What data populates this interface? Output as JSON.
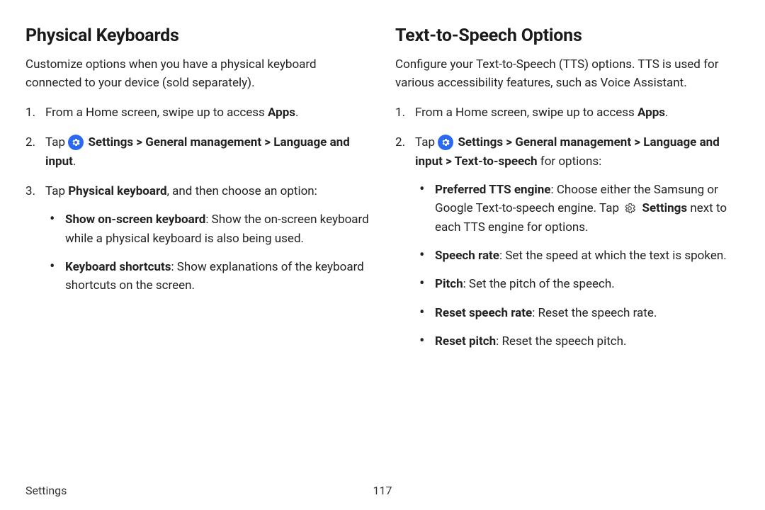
{
  "left": {
    "heading": "Physical Keyboards",
    "intro": "Customize options when you have a physical keyboard connected to your device (sold separately).",
    "step1_pre": "From a Home screen, swipe up to access ",
    "step1_bold": "Apps",
    "step1_post": ".",
    "step2_pre": "Tap ",
    "step2_bold": "Settings > General management > Language and input",
    "step2_post": ".",
    "step3_pre": "Tap ",
    "step3_bold": "Physical keyboard",
    "step3_post": ", and then choose an option:",
    "bullet1_bold": "Show on-screen keyboard",
    "bullet1_text": ": Show the on-screen keyboard while a physical keyboard is also being used.",
    "bullet2_bold": "Keyboard shortcuts",
    "bullet2_text": ": Show explanations of the keyboard shortcuts on the screen."
  },
  "right": {
    "heading": "Text-to-Speech Options",
    "intro": "Configure your Text-to-Speech (TTS) options. TTS is used for various accessibility features, such as Voice Assistant.",
    "step1_pre": "From a Home screen, swipe up to access ",
    "step1_bold": "Apps",
    "step1_post": ".",
    "step2_pre": "Tap ",
    "step2_bold": "Settings > General management > Language and input > Text-to-speech",
    "step2_post": " for options:",
    "b1_bold": "Preferred TTS engine",
    "b1_text1": ": Choose either the Samsung or Google Text-to-speech engine. Tap ",
    "b1_bold2": "Settings",
    "b1_text2": " next to each TTS engine for options.",
    "b2_bold": "Speech rate",
    "b2_text": ": Set the speed at which the text is spoken.",
    "b3_bold": "Pitch",
    "b3_text": ": Set the pitch of the speech.",
    "b4_bold": "Reset speech rate",
    "b4_text": ": Reset the speech rate.",
    "b5_bold": "Reset pitch",
    "b5_text": ": Reset the speech pitch."
  },
  "footer": {
    "section": "Settings",
    "page": "117"
  }
}
